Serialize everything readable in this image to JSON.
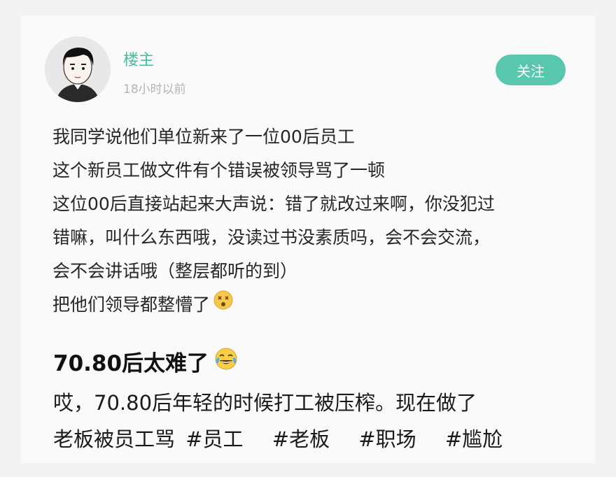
{
  "post": {
    "username": "楼主",
    "timestamp": "18小时以前",
    "follow_label": "关注",
    "accent_color": "#58c7ad",
    "lines": [
      "我同学说他们单位新来了一位00后员工",
      "这个新员工做文件有个错误被领导骂了一顿",
      "这位00后直接站起来大声说：错了就改过来啊，你没犯过",
      "错嘛，叫什么东西哦，没读过书没素质吗，会不会交流，",
      "会不会讲话哦（整层都听的到）",
      "把他们领导都整懵了"
    ],
    "last_line_emoji": "dizzy-face-emoji"
  },
  "caption": {
    "title": "70.80后太难了",
    "title_emoji": "tears-of-joy-emoji",
    "line1": "哎，70.80后年轻的时候打工被压榨。现在做了",
    "line2_text": "老板被员工骂",
    "hashtags": [
      "#员工",
      "#老板",
      "#职场",
      "#尴尬"
    ]
  }
}
